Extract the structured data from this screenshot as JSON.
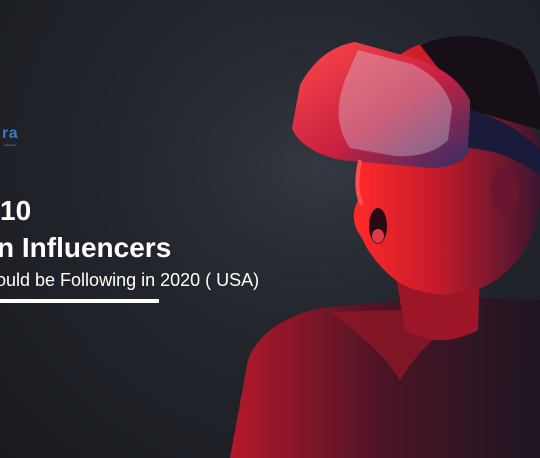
{
  "logo": {
    "text": "ra",
    "tagline": "solutions",
    "color": "#2f7fc9"
  },
  "headline": {
    "line1": "10",
    "line2": "n Influencers",
    "line3": "ould be Following in 2020 ( USA)"
  },
  "colors": {
    "background": "#1f2228",
    "text": "#ffffff",
    "accent_red": "#ff2a2a",
    "headset_blue": "#3a3f8f"
  }
}
